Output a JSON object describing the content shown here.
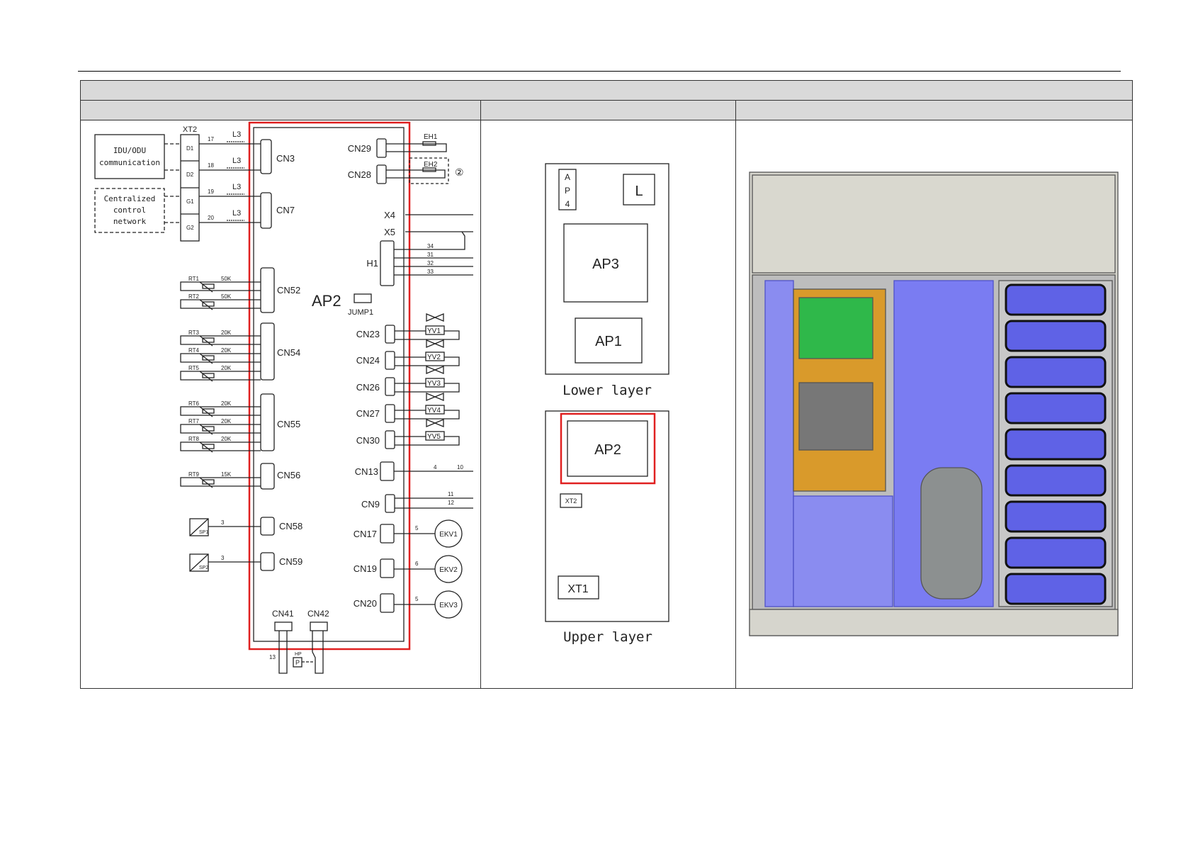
{
  "wiring": {
    "board": "AP2",
    "terminal_block": "XT2",
    "terminals": [
      "D1",
      "D2",
      "G1",
      "G2"
    ],
    "wire_numbers": [
      "17",
      "18",
      "19",
      "20"
    ],
    "filter": "L3",
    "idu_box": [
      "IDU/ODU",
      "communication"
    ],
    "central_box": [
      "Centralized",
      "control",
      "network"
    ],
    "left_connectors": [
      "CN3",
      "CN7",
      "CN52",
      "CN54",
      "CN55",
      "CN56",
      "CN58",
      "CN59"
    ],
    "sensors": [
      {
        "name": "RT1",
        "value": "50K"
      },
      {
        "name": "RT2",
        "value": "50K"
      },
      {
        "name": "RT3",
        "value": "20K"
      },
      {
        "name": "RT4",
        "value": "20K"
      },
      {
        "name": "RT5",
        "value": "20K"
      },
      {
        "name": "RT6",
        "value": "20K"
      },
      {
        "name": "RT7",
        "value": "20K"
      },
      {
        "name": "RT8",
        "value": "20K"
      },
      {
        "name": "RT9",
        "value": "15K"
      }
    ],
    "pressure_sensors": [
      {
        "name": "SP1",
        "wires": "3"
      },
      {
        "name": "SP2",
        "wires": "3"
      }
    ],
    "heaters": [
      "EH1",
      "EH2"
    ],
    "note_mark": "②",
    "right_connectors": [
      "CN29",
      "CN28",
      "X4",
      "X5",
      "H1",
      "CN23",
      "CN24",
      "CN26",
      "CN27",
      "CN30",
      "CN13",
      "CN9",
      "CN17",
      "CN19",
      "CN20"
    ],
    "h1_wires": [
      "34",
      "31",
      "32",
      "33"
    ],
    "jumper": "JUMP1",
    "valves": [
      "YV1",
      "YV2",
      "YV3",
      "YV4",
      "YV5"
    ],
    "cn13_wires": [
      "4",
      "10"
    ],
    "cn9_wires": [
      "11",
      "12"
    ],
    "ekv": [
      {
        "name": "EKV1",
        "wires": "5"
      },
      {
        "name": "EKV2",
        "wires": "6"
      },
      {
        "name": "EKV3",
        "wires": "5"
      }
    ],
    "bottom_connectors": [
      "CN41",
      "CN42"
    ],
    "cn41_wire": "13",
    "hp_switch": {
      "name": "HP",
      "symbol": "P"
    }
  },
  "layout_diagram": {
    "lower": {
      "boxes": [
        "A",
        "P",
        "4",
        "L",
        "AP3",
        "AP1"
      ],
      "caption": "Lower layer"
    },
    "upper": {
      "boxes": [
        "AP2",
        "XT2",
        "XT1"
      ],
      "caption": "Upper layer"
    }
  },
  "colors": {
    "highlight": "#e02020",
    "header_bg": "#d9d9d9",
    "panel_blue": "#7a7cf2",
    "pcb_green": "#2fb84a",
    "control_orange": "#d99a2b"
  }
}
